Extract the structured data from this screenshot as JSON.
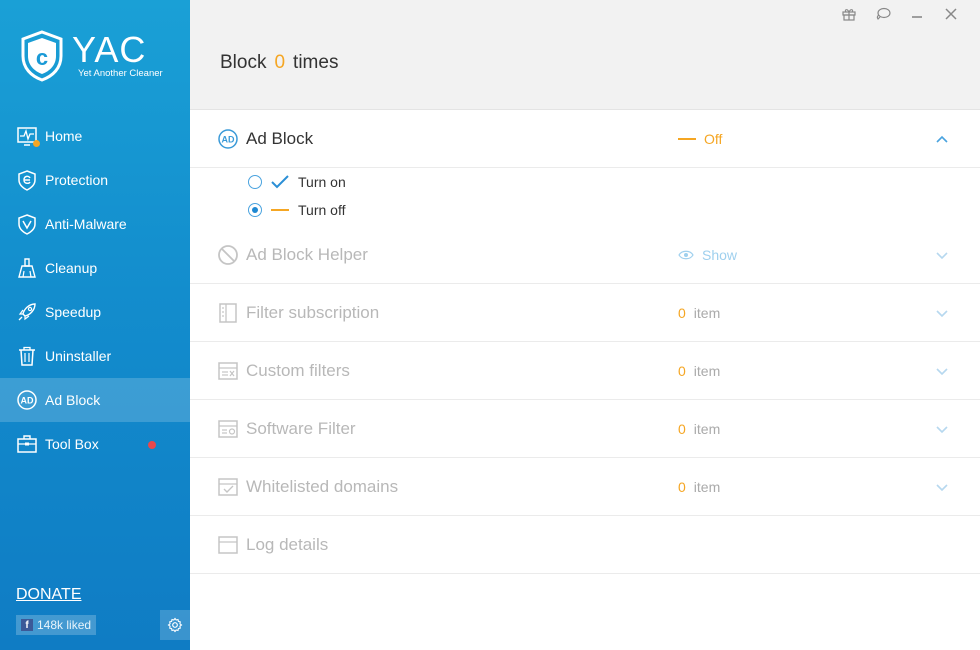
{
  "app": {
    "logo_title": "YAC",
    "logo_subtitle": "Yet Another Cleaner"
  },
  "sidebar": {
    "items": [
      {
        "label": "Home",
        "icon": "monitor-pulse-icon"
      },
      {
        "label": "Protection",
        "icon": "shield-e-icon"
      },
      {
        "label": "Anti-Malware",
        "icon": "shield-v-icon"
      },
      {
        "label": "Cleanup",
        "icon": "broom-icon"
      },
      {
        "label": "Speedup",
        "icon": "rocket-icon"
      },
      {
        "label": "Uninstaller",
        "icon": "trash-icon"
      },
      {
        "label": "Ad Block",
        "icon": "ad-icon"
      },
      {
        "label": "Tool Box",
        "icon": "toolbox-icon"
      }
    ],
    "active_item": "Ad Block",
    "donate": "DONATE",
    "fb_like": "148k liked"
  },
  "header": {
    "block_prefix": "Block",
    "block_count": "0",
    "block_suffix": "times"
  },
  "adblock": {
    "title": "Ad Block",
    "status": "Off",
    "options": {
      "on": "Turn on",
      "off": "Turn off"
    },
    "selected": "off"
  },
  "rows": [
    {
      "title": "Ad Block Helper",
      "status": "Show"
    },
    {
      "title": "Filter subscription",
      "count": "0",
      "unit": "item"
    },
    {
      "title": "Custom filters",
      "count": "0",
      "unit": "item"
    },
    {
      "title": "Software Filter",
      "count": "0",
      "unit": "item"
    },
    {
      "title": "Whitelisted domains",
      "count": "0",
      "unit": "item"
    },
    {
      "title": "Log details"
    }
  ],
  "colors": {
    "accent": "#1a9ad6",
    "orange": "#f5a623",
    "muted": "#b8b8b8"
  }
}
